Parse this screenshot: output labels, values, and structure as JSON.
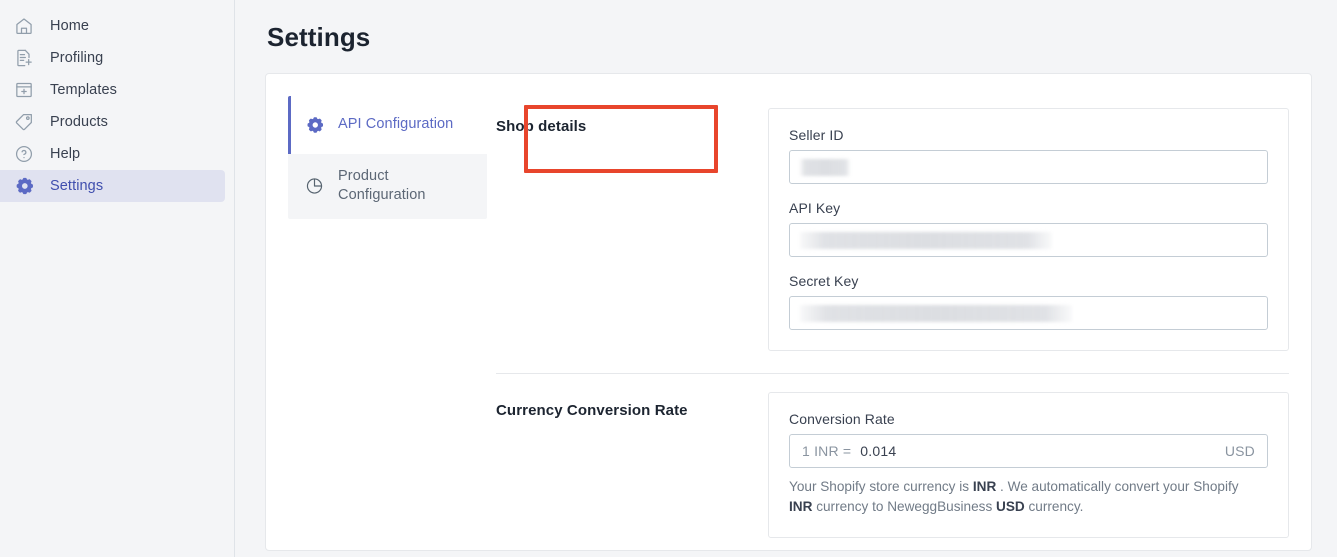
{
  "sidebar": {
    "items": [
      {
        "label": "Home",
        "icon": "home-icon",
        "active": false
      },
      {
        "label": "Profiling",
        "icon": "document-plus-icon",
        "active": false
      },
      {
        "label": "Templates",
        "icon": "window-plus-icon",
        "active": false
      },
      {
        "label": "Products",
        "icon": "tag-icon",
        "active": false
      },
      {
        "label": "Help",
        "icon": "help-circle-icon",
        "active": false
      },
      {
        "label": "Settings",
        "icon": "gear-icon",
        "active": true
      }
    ]
  },
  "page": {
    "title": "Settings"
  },
  "tabs": [
    {
      "label": "API Configuration",
      "icon": "gear-icon",
      "active": true,
      "highlighted": true
    },
    {
      "label": "Product Configuration",
      "icon": "pie-chart-icon",
      "active": false,
      "highlighted": false
    }
  ],
  "sections": [
    {
      "title": "Shop details",
      "fields": [
        {
          "label": "Seller ID",
          "value": "",
          "redacted": true,
          "redacted_width": 50
        },
        {
          "label": "API Key",
          "value": "",
          "redacted": true,
          "redacted_width": 252
        },
        {
          "label": "Secret Key",
          "value": "",
          "redacted": true,
          "redacted_width": 272
        }
      ]
    },
    {
      "title": "Currency Conversion Rate",
      "rate": {
        "label": "Conversion Rate",
        "prefix": "1 INR =",
        "value": "0.014",
        "suffix": "USD",
        "help_parts": [
          {
            "text": "Your Shopify store currency is ",
            "bold": false
          },
          {
            "text": "INR",
            "bold": true
          },
          {
            "text": " . We automatically convert your Shopify ",
            "bold": false
          },
          {
            "text": "INR",
            "bold": true
          },
          {
            "text": " currency to NeweggBusiness ",
            "bold": false
          },
          {
            "text": "USD",
            "bold": true
          },
          {
            "text": " currency.",
            "bold": false
          }
        ]
      }
    }
  ],
  "colors": {
    "accent": "#5c6ac4",
    "highlight_box": "#e8452c",
    "sidebar_active_bg": "#e0e2f0",
    "page_bg": "#f4f5f7"
  }
}
